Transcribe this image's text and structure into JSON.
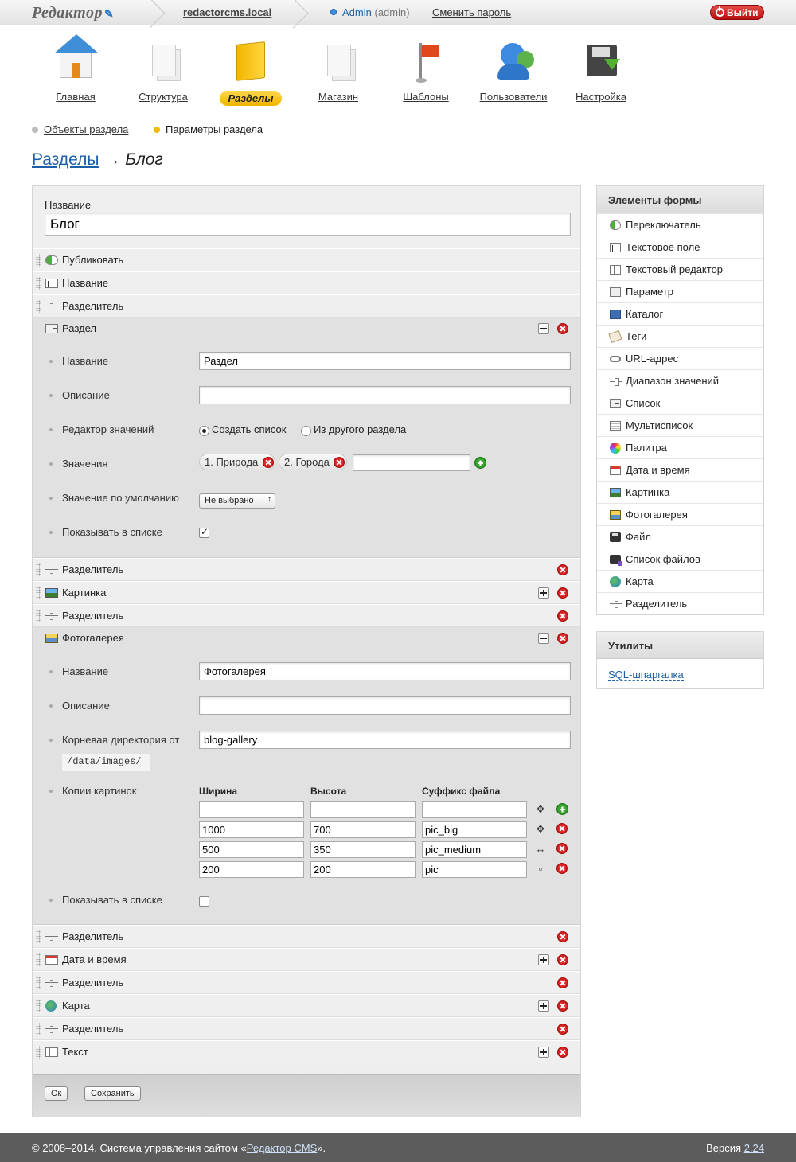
{
  "header": {
    "logo": "Редактор",
    "site": "redactorcms.local",
    "user_link": "Admin",
    "user_role": "(admin)",
    "change_password": "Сменить пароль",
    "logout": "Выйти"
  },
  "nav": {
    "items": [
      {
        "label": "Главная",
        "icon": "house-icon"
      },
      {
        "label": "Структура",
        "icon": "structure-icon"
      },
      {
        "label": "Разделы",
        "icon": "folder-icon",
        "active": true
      },
      {
        "label": "Магазин",
        "icon": "shop-icon"
      },
      {
        "label": "Шаблоны",
        "icon": "flag-icon"
      },
      {
        "label": "Пользователи",
        "icon": "users-icon"
      },
      {
        "label": "Настройка",
        "icon": "disk-icon"
      }
    ]
  },
  "subnav": {
    "items": [
      {
        "label": "Объекты раздела",
        "link": true
      },
      {
        "label": "Параметры раздела",
        "link": false
      }
    ]
  },
  "page": {
    "crumb": "Разделы",
    "arrow": "→",
    "current": "Блог"
  },
  "form": {
    "name_label": "Название",
    "name_value": "Блог",
    "fields": [
      {
        "label": "Публиковать",
        "icon": "toggle-icon"
      },
      {
        "label": "Название",
        "icon": "text-field-icon"
      },
      {
        "label": "Разделитель",
        "icon": "divider-icon"
      }
    ],
    "section": {
      "title": "Раздел",
      "icon": "select-icon",
      "name_label": "Название",
      "name_value": "Раздел",
      "desc_label": "Описание",
      "desc_value": "",
      "editor_label": "Редактор значений",
      "editor_opt1": "Создать список",
      "editor_opt2": "Из другого раздела",
      "values_label": "Значения",
      "values": [
        "1. Природа",
        "2. Города"
      ],
      "default_label": "Значение по умолчанию",
      "default_value": "Не выбрано",
      "show_label": "Показывать в списке",
      "show_checked": true
    },
    "middle_fields": [
      {
        "label": "Разделитель",
        "icon": "divider-icon"
      },
      {
        "label": "Картинка",
        "icon": "picture-icon"
      },
      {
        "label": "Разделитель",
        "icon": "divider-icon"
      }
    ],
    "gallery": {
      "title": "Фотогалерея",
      "icon": "gallery-icon",
      "name_label": "Название",
      "name_value": "Фотогалерея",
      "desc_label": "Описание",
      "desc_value": "",
      "root_label": "Корневая директория от",
      "root_path": "/data/images/",
      "root_value": "blog-gallery",
      "copies_label": "Копии картинок",
      "col_width": "Ширина",
      "col_height": "Высота",
      "col_suffix": "Суффикс файла",
      "copies": [
        {
          "w": "1000",
          "h": "700",
          "s": "pic_big"
        },
        {
          "w": "500",
          "h": "350",
          "s": "pic_medium"
        },
        {
          "w": "200",
          "h": "200",
          "s": "pic"
        }
      ],
      "show_label": "Показывать в списке",
      "show_checked": false
    },
    "bottom_fields": [
      {
        "label": "Разделитель",
        "icon": "divider-icon"
      },
      {
        "label": "Дата и время",
        "icon": "calendar-icon"
      },
      {
        "label": "Разделитель",
        "icon": "divider-icon"
      },
      {
        "label": "Карта",
        "icon": "globe-icon"
      },
      {
        "label": "Разделитель",
        "icon": "divider-icon"
      },
      {
        "label": "Текст",
        "icon": "textarea-icon"
      }
    ],
    "ok_button": "Ок",
    "save_button": "Сохранить"
  },
  "sidebar": {
    "elements_title": "Элементы формы",
    "elements": [
      "Переключатель",
      "Текстовое поле",
      "Текстовый редактор",
      "Параметр",
      "Каталог",
      "Теги",
      "URL-адрес",
      "Диапазон значений",
      "Список",
      "Мультисписок",
      "Палитра",
      "Дата и время",
      "Картинка",
      "Фотогалерея",
      "Файл",
      "Список файлов",
      "Карта",
      "Разделитель"
    ],
    "utils_title": "Утилиты",
    "utils_link": "SQL-шпаргалка"
  },
  "footer": {
    "copy": "© 2008–2014. Система управления сайтом «",
    "cms_link": "Редактор CMS",
    "copy_end": "».",
    "version_label": "Версия",
    "version": "2.24"
  }
}
